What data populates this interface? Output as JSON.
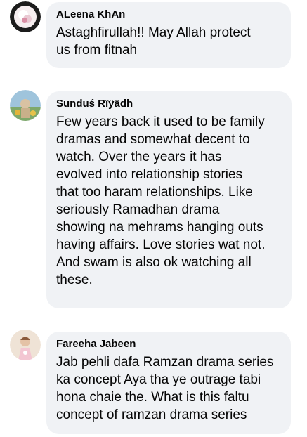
{
  "comments": [
    {
      "author": "ALeena KhAn",
      "lines": [
        "Astaghfirullah!! May Allah protect",
        "us from fitnah"
      ],
      "avatar_icon": "profile-photo-pink-white"
    },
    {
      "author": "Sunduś Rïÿädh",
      "lines": [
        "Few years back it used to be family",
        "dramas and somewhat decent to",
        "watch. Over the years it has",
        "evolved into relationship stories",
        "that too haram relationships. Like",
        "seriously Ramadhan drama",
        "showing na mehrams hanging outs",
        "having affairs. Love stories wat not.",
        "And swam is also ok watching all",
        "these."
      ],
      "avatar_icon": "profile-photo-sky-flowers"
    },
    {
      "author": "Fareeha Jabeen",
      "lines": [
        "Jab pehli dafa Ramzan drama series",
        "ka concept Aya tha ye outrage tabi",
        "hona chaie the. What is this faltu",
        "concept of ramzan drama series"
      ],
      "avatar_icon": "profile-photo-child"
    }
  ],
  "colors": {
    "bubble_bg": "#f0f2f5",
    "text": "#050505"
  }
}
